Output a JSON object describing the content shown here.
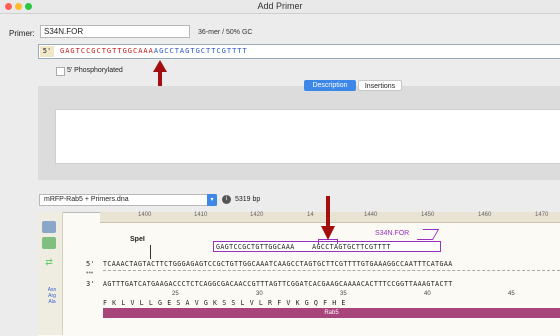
{
  "window": {
    "title": "Add Primer"
  },
  "primer": {
    "label": "Primer:",
    "name": "S34N.FOR",
    "stats": "36-mer / 50% GC",
    "five_prime": "5'",
    "sequence_red": "GAGTCCGCTGTTGGCAAA",
    "sequence_blue": "AGCCTAGTGCTTCGTTTT",
    "phosphorylated_label": "5' Phosphorylated"
  },
  "tabs": [
    {
      "label": "Description",
      "active": true
    },
    {
      "label": "Insertions",
      "active": false
    }
  ],
  "file": {
    "name": "mRFP-Rab5 + Primers.dna",
    "size": "5319 bp",
    "info_icon": "i"
  },
  "ruler": {
    "ticks": [
      "1400",
      "1410",
      "1420",
      "14",
      "1440",
      "1450",
      "1460",
      "1470"
    ]
  },
  "map": {
    "enzyme": "SpeI",
    "primer_feature_label": "S34N.FOR",
    "primer_sequence": "GAGTCCGCTGTTGGCAAA    AGCCTAGTGCTTCGTTTT",
    "five_label": "5'",
    "three_label": "3'",
    "dots": "•••",
    "top_strand": "TCAAACTAGTACTTCTGGGAGAGTCCGCTGTTGGCAAATCAAGCCTAGTGCTTCGTTTTGTGAAAGGCCAATTTCATGAA",
    "bottom_strand": "AGTTTGATCATGAAGACCCTCTCAGGCGACAACCGTTTAGTTCGGATCACGAAGCAAAACACTTTCCGGTTAAAGTACTT",
    "aa_numbers": [
      "25",
      "30",
      "35",
      "40",
      "45"
    ],
    "aa_sequence": "FKLVLLGESAVGKSSLVLRFVKGQFHE",
    "feature_name": "Rab5",
    "aa_button_label": "Asn Arg Ala"
  },
  "colors": {
    "primer_purple": "#9b2fc0",
    "rab5_feature": "#a8457a",
    "arrow_red": "#a30f0f",
    "accent_blue": "#3d87e8"
  }
}
